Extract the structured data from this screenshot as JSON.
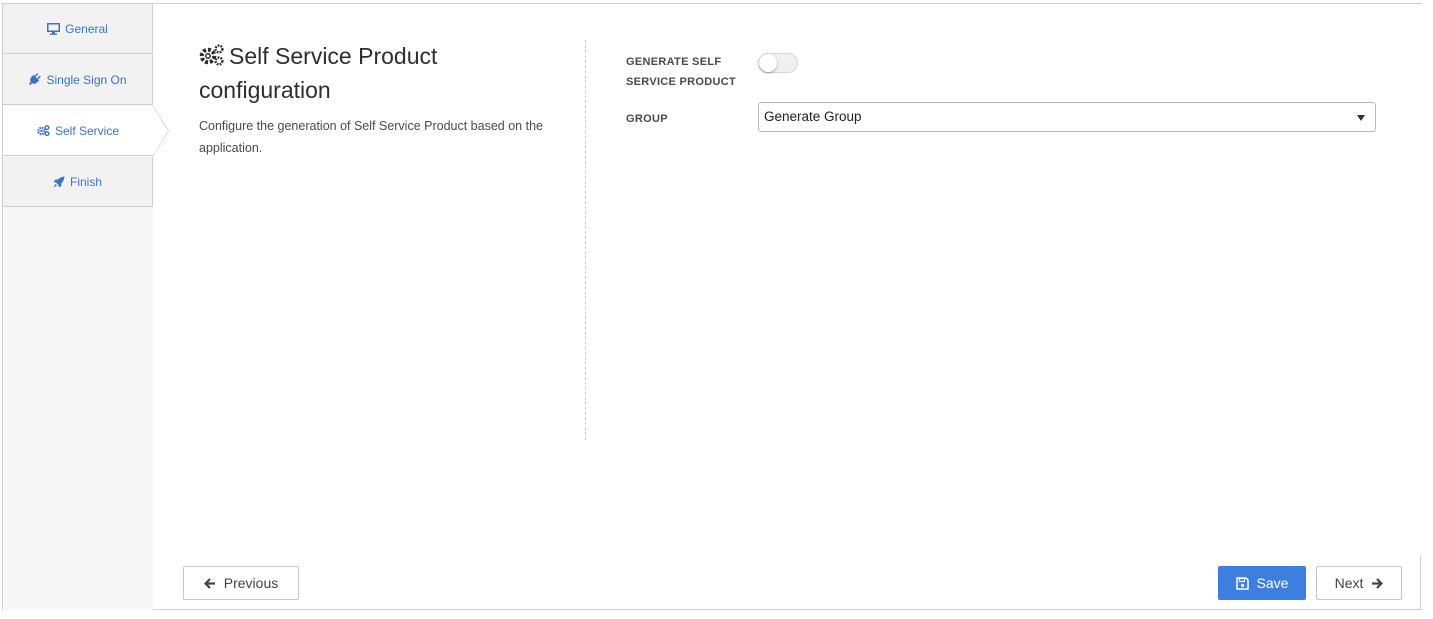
{
  "sidebar": {
    "steps": [
      {
        "label": "General",
        "icon": "monitor-icon"
      },
      {
        "label": "Single Sign On",
        "icon": "plug-icon"
      },
      {
        "label": "Self Service",
        "icon": "gears-icon",
        "active": true
      },
      {
        "label": "Finish",
        "icon": "rocket-icon"
      }
    ]
  },
  "section": {
    "title": "Self Service Product configuration",
    "icon": "gears-icon",
    "description": "Configure the generation of Self Service Product based on the application."
  },
  "form": {
    "generate_label_line1": "GENERATE SELF",
    "generate_label_line2": "SERVICE PRODUCT",
    "generate_enabled": false,
    "group_label": "GROUP",
    "group_value": "Generate Group"
  },
  "footer": {
    "previous_label": "Previous",
    "save_label": "Save",
    "next_label": "Next"
  },
  "colors": {
    "accent": "#3d7fe0",
    "link": "#3b73c9"
  }
}
